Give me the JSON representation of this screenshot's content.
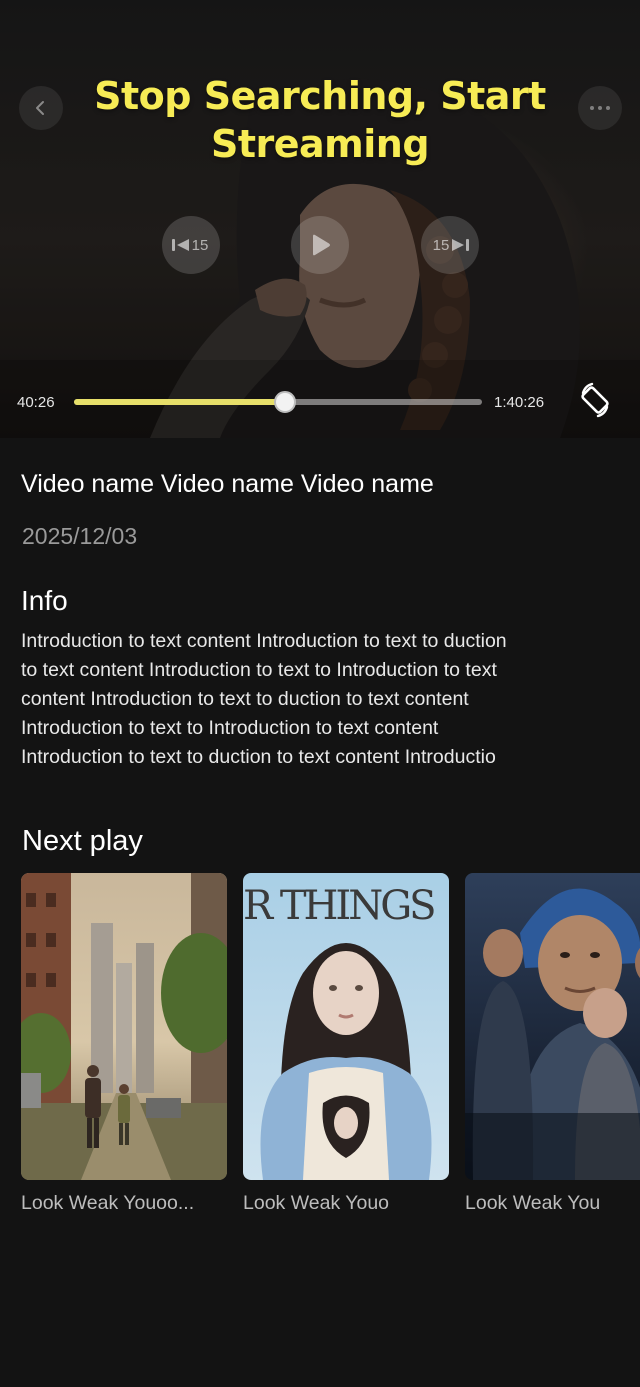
{
  "player": {
    "headline": "Stop Searching, Start Streaming",
    "rewind_seconds": "15",
    "forward_seconds": "15",
    "current_time": "40:26",
    "total_time": "1:40:26",
    "progress_fraction": 0.517,
    "accent_color": "#e7df6a",
    "headline_color": "#f7ec55",
    "icons": [
      "back-icon",
      "more-icon",
      "rewind-icon",
      "play-icon",
      "forward-icon",
      "rotate-screen-icon"
    ]
  },
  "video": {
    "title": "Video name Video name Video name",
    "date": "2025/12/03"
  },
  "info": {
    "heading": "Info",
    "lines": [
      "Introduction to text content Introduction to text to duction",
      "to text content Introduction to text to Introduction to text",
      "content Introduction to text to duction to text content",
      "Introduction to text to Introduction to text content",
      "Introduction to text to duction to text content Introductio"
    ]
  },
  "next_play": {
    "heading": "Next play",
    "items": [
      {
        "title": "Look Weak Youoo..."
      },
      {
        "title": "Look Weak Youo",
        "poster_text": "R THINGS"
      },
      {
        "title": "Look Weak You"
      }
    ]
  }
}
